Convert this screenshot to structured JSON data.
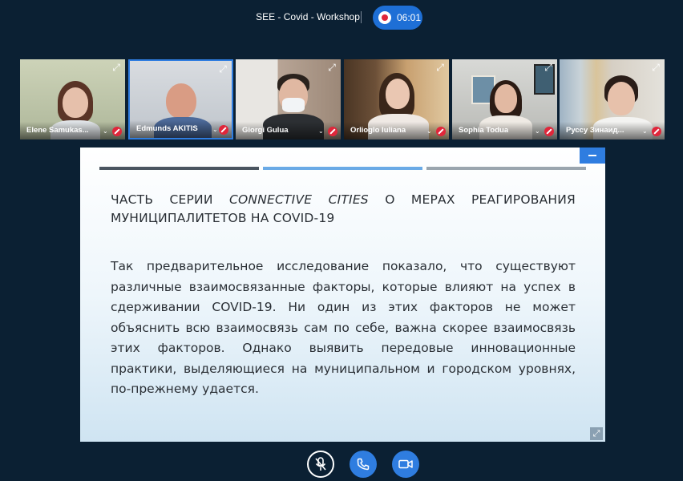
{
  "meeting": {
    "title": "SEE - Covid - Workshop",
    "recording_time": "06:01",
    "record_icon": "record-icon"
  },
  "participants": [
    {
      "name": "Elene Samukas...",
      "muted": true,
      "active": false
    },
    {
      "name": "Edmunds AKITIS",
      "muted": true,
      "active": true
    },
    {
      "name": "Giorgi Gulua",
      "muted": true,
      "active": false
    },
    {
      "name": "Orlioglo Iuliana",
      "muted": true,
      "active": false
    },
    {
      "name": "Sophia Todua",
      "muted": true,
      "active": false
    },
    {
      "name": "Руссу Зинаид...",
      "muted": true,
      "active": false
    }
  ],
  "slide": {
    "heading_part1": "ЧАСТЬ СЕРИИ ",
    "heading_italic": "CONNECTIVE CITIES",
    "heading_part2": " О МЕРАХ РЕАГИРОВАНИЯ МУНИЦИПАЛИТЕТОВ НА COVID-19",
    "body": "Так предварительное исследование показало, что существуют различные взаимосвязанные факторы, которые влияют на успех в сдерживании COVID-19. Ни один из этих факторов не может объяснить всю взаимосвязь сам по себе, важна скорее взаимосвязь этих факторов. Однако выявить передовые инновационные практики, выделяющиеся на муниципальном и городском уровнях, по-прежнему удается."
  },
  "controls": {
    "mic_icon": "mic-off-icon",
    "phone_icon": "phone-icon",
    "video_icon": "video-camera-icon"
  },
  "colors": {
    "background": "#0b2033",
    "accent": "#2f7de0",
    "record_red": "#e0263a"
  }
}
